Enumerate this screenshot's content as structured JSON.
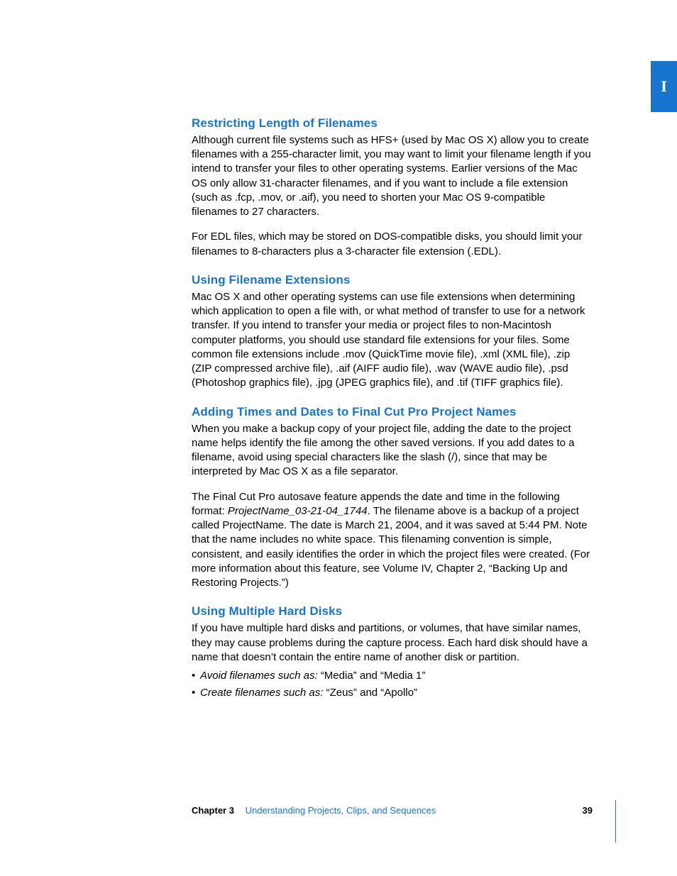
{
  "tab": "I",
  "sections": [
    {
      "heading": "Restricting Length of Filenames",
      "paragraphs": [
        "Although current file systems such as HFS+ (used by Mac OS X) allow you to create filenames with a 255-character limit, you may want to limit your filename length if you intend to transfer your files to other operating systems. Earlier versions of the Mac OS only allow 31-character filenames, and if you want to include a file extension (such as .fcp, .mov, or .aif), you need to shorten your Mac OS 9-compatible filenames to 27 characters.",
        "For EDL files, which may be stored on DOS-compatible disks, you should limit your filenames to 8-characters plus a 3-character file extension (.EDL)."
      ]
    },
    {
      "heading": "Using Filename Extensions",
      "paragraphs": [
        "Mac OS X and other operating systems can use file extensions when determining which application to open a file with, or what method of transfer to use for a network transfer. If you intend to transfer your media or project files to non-Macintosh computer platforms, you should use standard file extensions for your files. Some common file extensions include .mov (QuickTime movie file), .xml (XML file), .zip (ZIP compressed archive file), .aif (AIFF audio file), .wav (WAVE audio file), .psd (Photoshop graphics file), .jpg (JPEG graphics file), and .tif (TIFF graphics file)."
      ]
    },
    {
      "heading": "Adding Times and Dates to Final Cut Pro Project Names",
      "paragraphs": [
        "When you make a backup copy of your project file, adding the date to the project name helps identify the file among the other saved versions. If you add dates to a filename, avoid using special characters like the slash (/), since that may be interpreted by Mac OS X as a file separator."
      ],
      "richParagraph": {
        "prefix": "The Final Cut Pro autosave feature appends the date and time in the following format: ",
        "italic": "ProjectName_03-21-04_1744",
        "suffix": ". The filename above is a backup of a project called ProjectName. The date is March 21, 2004, and it was saved at 5:44 PM. Note that the name includes no white space. This filenaming convention is simple, consistent, and easily identifies the order in which the project files were created. (For more information about this feature, see Volume IV, Chapter 2, “Backing Up and Restoring Projects.”)"
      }
    },
    {
      "heading": "Using Multiple Hard Disks",
      "paragraphs": [
        "If you have multiple hard disks and partitions, or volumes, that have similar names, they may cause problems during the capture process. Each hard disk should have a name that doesn’t contain the entire name of another disk or partition."
      ],
      "bullets": [
        {
          "label": "Avoid filenames such as:  ",
          "text": "“Media” and “Media 1”"
        },
        {
          "label": "Create filenames such as:  ",
          "text": "“Zeus” and “Apollo”"
        }
      ]
    }
  ],
  "footer": {
    "chapter": "Chapter 3",
    "title": "Understanding Projects, Clips, and Sequences",
    "page": "39"
  }
}
